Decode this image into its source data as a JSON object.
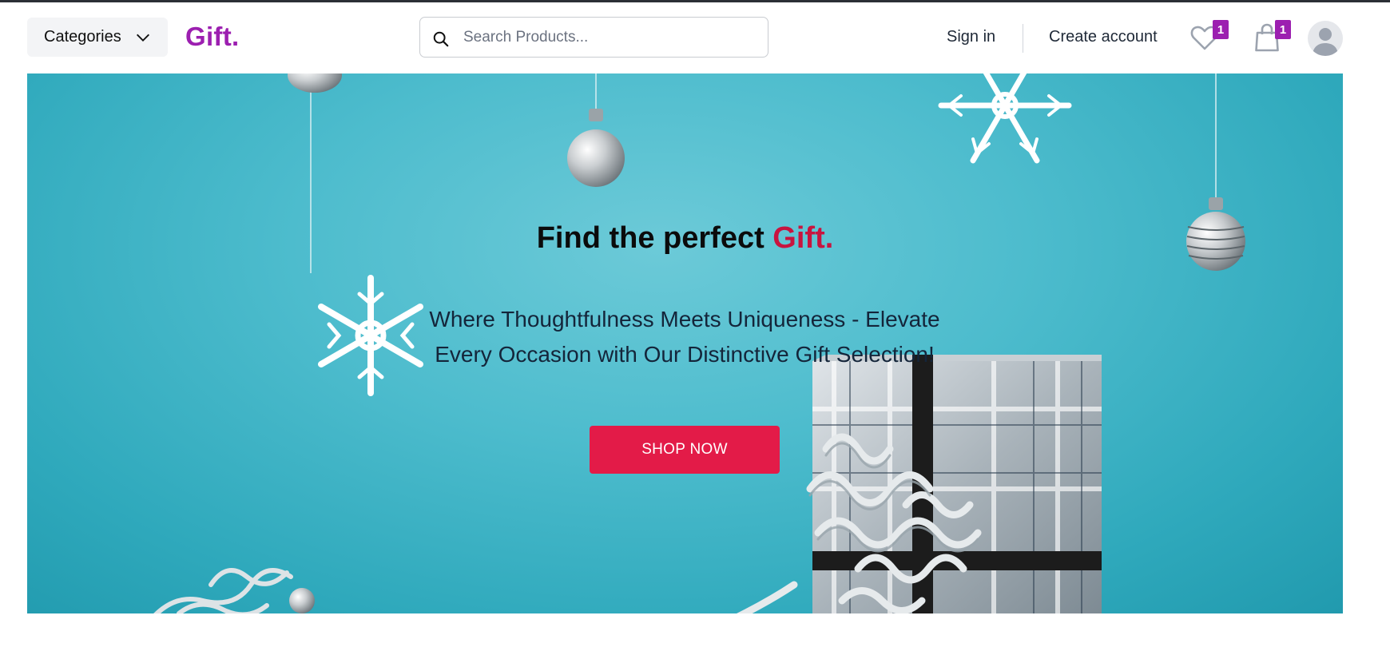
{
  "header": {
    "categories_label": "Categories",
    "logo_text": "Gift.",
    "search": {
      "placeholder": "Search Products...",
      "value": ""
    },
    "sign_in_label": "Sign in",
    "create_account_label": "Create account",
    "wishlist": {
      "icon": "heart-icon",
      "count": "1"
    },
    "cart": {
      "icon": "shopping-bag-icon",
      "count": "1"
    },
    "avatar_icon": "user-avatar-icon"
  },
  "hero": {
    "title_prefix": "Find the perfect ",
    "title_accent": "Gift.",
    "subtitle": "Where Thoughtfulness Meets Uniqueness - Elevate Every Occasion with Our Distinctive Gift Selection!",
    "cta_label": "SHOP NOW"
  },
  "colors": {
    "brand": "#9c1fb0",
    "accent": "#c8143f",
    "cta": "#e31b48",
    "hero_background": "#4dbccd"
  }
}
